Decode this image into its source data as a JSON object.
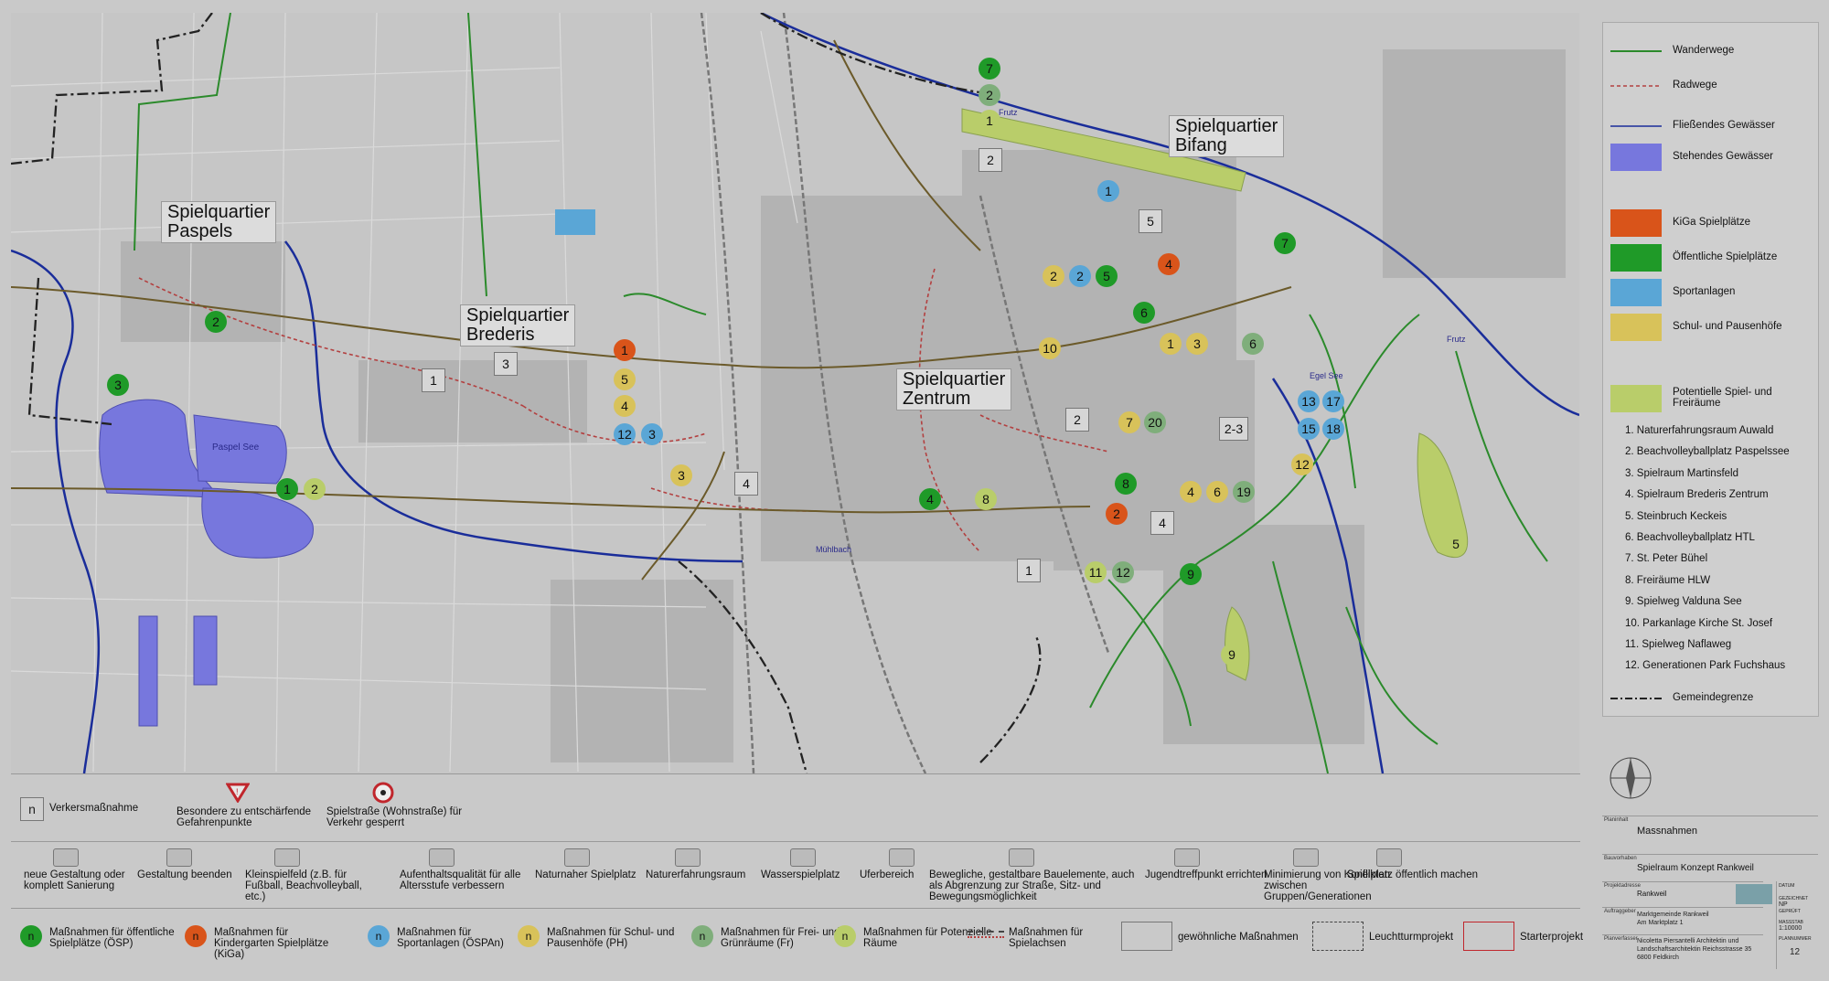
{
  "colors": {
    "map_bg": "#c6c6c6",
    "ospielplatz": "#1f9a28",
    "kiga": "#d9541a",
    "sport": "#5aa6d6",
    "schule": "#d8c25a",
    "frei": "#7fae7b",
    "potenziell": "#b9cd6a",
    "water": "#7777dd",
    "walkway": "#2b8a2b",
    "radweg": "#b34040",
    "border": "#222222"
  },
  "map": {
    "districts": [
      {
        "line1": "Spielquartier",
        "line2": "Paspels"
      },
      {
        "line1": "Spielquartier",
        "line2": "Brederis"
      },
      {
        "line1": "Spielquartier",
        "line2": "Zentrum"
      },
      {
        "line1": "Spielquartier",
        "line2": "Bifang"
      }
    ],
    "water_labels": [
      "Paspel See",
      "Frutz",
      "Mühlbach",
      "Egel See",
      "Frutz"
    ],
    "markers": [
      {
        "label": "7",
        "type": "ospielplatz"
      },
      {
        "label": "2",
        "type": "frei"
      },
      {
        "label": "1",
        "type": "potenziell"
      },
      {
        "label": "2",
        "type": "plain"
      },
      {
        "label": "1",
        "type": "sport"
      },
      {
        "label": "5",
        "type": "plain"
      },
      {
        "label": "7",
        "type": "ospielplatz"
      },
      {
        "label": "4",
        "type": "kiga"
      },
      {
        "label": "2",
        "type": "schule"
      },
      {
        "label": "2",
        "type": "sport"
      },
      {
        "label": "5",
        "type": "ospielplatz"
      },
      {
        "label": "6",
        "type": "ospielplatz"
      },
      {
        "label": "10",
        "type": "schule"
      },
      {
        "label": "1",
        "type": "schule"
      },
      {
        "label": "3",
        "type": "schule"
      },
      {
        "label": "6",
        "type": "frei"
      },
      {
        "label": "2",
        "type": "ospielplatz"
      },
      {
        "label": "3",
        "type": "ospielplatz"
      },
      {
        "label": "1",
        "type": "plain"
      },
      {
        "label": "3",
        "type": "plain"
      },
      {
        "label": "1",
        "type": "kiga"
      },
      {
        "label": "5",
        "type": "schule"
      },
      {
        "label": "4",
        "type": "schule"
      },
      {
        "label": "12",
        "type": "sport"
      },
      {
        "label": "3",
        "type": "sport"
      },
      {
        "label": "3",
        "type": "schule"
      },
      {
        "label": "4",
        "type": "plain"
      },
      {
        "label": "1",
        "type": "ospielplatz"
      },
      {
        "label": "2",
        "type": "potenziell"
      },
      {
        "label": "2",
        "type": "plain"
      },
      {
        "label": "7",
        "type": "schule"
      },
      {
        "label": "20",
        "type": "frei"
      },
      {
        "label": "2-3",
        "type": "plain"
      },
      {
        "label": "13",
        "type": "sport"
      },
      {
        "label": "17",
        "type": "sport"
      },
      {
        "label": "15",
        "type": "sport"
      },
      {
        "label": "18",
        "type": "sport"
      },
      {
        "label": "12",
        "type": "schule"
      },
      {
        "label": "4",
        "type": "ospielplatz"
      },
      {
        "label": "8",
        "type": "potenziell"
      },
      {
        "label": "8",
        "type": "ospielplatz"
      },
      {
        "label": "2",
        "type": "kiga"
      },
      {
        "label": "4",
        "type": "schule"
      },
      {
        "label": "6",
        "type": "schule"
      },
      {
        "label": "19",
        "type": "frei"
      },
      {
        "label": "4",
        "type": "plain"
      },
      {
        "label": "5",
        "type": "potenziell"
      },
      {
        "label": "1",
        "type": "plain"
      },
      {
        "label": "11",
        "type": "potenziell"
      },
      {
        "label": "12",
        "type": "frei"
      },
      {
        "label": "9",
        "type": "ospielplatz"
      },
      {
        "label": "9",
        "type": "potenziell"
      }
    ]
  },
  "legend_right": {
    "lines": [
      {
        "label": "Wanderwege"
      },
      {
        "label": "Radwege"
      },
      {
        "label": "Fließendes Gewässer"
      },
      {
        "label": "Stehendes Gewässer"
      }
    ],
    "areas": [
      {
        "label": "KiGa Spielplätze"
      },
      {
        "label": "Öffentliche Spielplätze"
      },
      {
        "label": "Sportanlagen"
      },
      {
        "label": "Schul- und Pausenhöfe"
      },
      {
        "label": "Potentielle Spiel- und Freiräume"
      }
    ],
    "numbered": [
      "1. Naturerfahrungsraum Auwald",
      "2. Beachvolleyballplatz Paspelssee",
      "3. Spielraum Martinsfeld",
      "4. Spielraum Brederis Zentrum",
      "5. Steinbruch Keckeis",
      "6. Beachvolleyballplatz HTL",
      "7. St. Peter Bühel",
      "8. Freiräume HLW",
      "9. Spielweg Valduna See",
      "10. Parkanlage Kirche St. Josef",
      "11. Spielweg Naflaweg",
      "12. Generationen Park Fuchshaus"
    ],
    "boundary": "Gemeindegrenze"
  },
  "legend_bottom": {
    "row1": [
      {
        "key": "n",
        "label": "Verkersmaßnahme"
      },
      {
        "label": "Besondere zu entschärfende Gefahrenpunkte"
      },
      {
        "label": "Spielstraße (Wohnstraße) für Verkehr gesperrt"
      }
    ],
    "row2": [
      "neue Gestaltung oder komplett Sanierung",
      "Gestaltung beenden",
      "Kleinspielfeld (z.B. für Fußball, Beachvolleyball, etc.)",
      "Aufenthaltsqualität für alle Altersstufe verbessern",
      "Naturnaher Spielplatz",
      "Naturerfahrungsraum",
      "Wasserspielplatz",
      "Uferbereich",
      "Bewegliche, gestaltbare Bauelemente, auch als Abgrenzung zur Straße, Sitz- und Bewegungsmöglichkeit",
      "Jugendtreffpunkt errichten",
      "Minimierung von Konflikten zwischen Gruppen/Generationen",
      "Spielplatz öffentlich machen"
    ],
    "row3": [
      {
        "key": "n",
        "label": "Maßnahmen für öffentliche Spielplätze (ÖSP)"
      },
      {
        "key": "n",
        "label": "Maßnahmen für Kindergarten Spielplätze (KiGa)"
      },
      {
        "key": "n",
        "label": "Maßnahmen für Sportanlagen (ÖSPAn)"
      },
      {
        "key": "n",
        "label": "Maßnahmen für Schul- und Pausenhöfe (PH)"
      },
      {
        "key": "n",
        "label": "Maßnahmen für Frei- und Grünräume (Fr)"
      },
      {
        "key": "n",
        "label": "Maßnahmen für Potenzielle Räume"
      },
      {
        "label": "Maßnahmen für Spielachsen"
      },
      {
        "label": "gewöhnliche Maßnahmen"
      },
      {
        "label": "Leuchtturmprojekt"
      },
      {
        "label": "Starterprojekt"
      }
    ]
  },
  "title_block": {
    "planinhalt_key": "Planinhalt",
    "planinhalt": "Massnahmen",
    "bauvorhaben_key": "Bauvorhaben",
    "bauvorhaben": "Spielraum Konzept Rankweil",
    "projektnr_key": "Projektadresse",
    "projekt": "Rankweil",
    "auftraggeber_key": "Auftraggeber",
    "auftraggeber": "Marktgemeinde Rankweil",
    "auftraggeber2": "Am Marktplatz 1",
    "planverfasser_key": "Planverfasser",
    "planverfasser": "Nicoletta Piersantelli Architektin und",
    "planverfasser2": "Landschaftsarchitektin Reichsstrasse 35",
    "planverfasser3": "6800 Feldkirch",
    "datum_key": "DATUM",
    "gezeichnet_key": "GEZEICHNET",
    "gezeichnet": "NP",
    "geprueft_key": "GEPRÜFT",
    "massstab_key": "MASSSTAB",
    "massstab": "1:10000",
    "plannummer_key": "PLANNUMMER",
    "plannummer": "12"
  }
}
